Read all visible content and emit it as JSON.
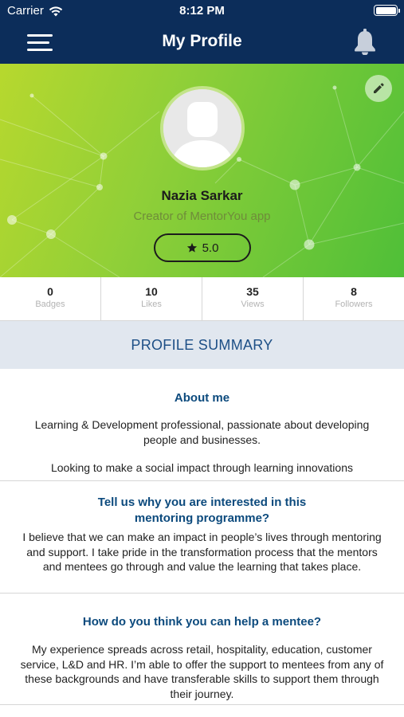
{
  "status_bar": {
    "carrier": "Carrier",
    "time": "8:12 PM"
  },
  "nav": {
    "title": "My Profile",
    "menu_icon": "hamburger-menu-icon",
    "bell_icon": "bell-icon"
  },
  "profile": {
    "name": "Nazia Sarkar",
    "role": "Creator of MentorYou app",
    "rating": "5.0",
    "rating_icon": "star-icon",
    "edit_icon": "pencil-icon"
  },
  "stats": [
    {
      "value": "0",
      "label": "Badges"
    },
    {
      "value": "10",
      "label": "Likes"
    },
    {
      "value": "35",
      "label": "Views"
    },
    {
      "value": "8",
      "label": "Followers"
    }
  ],
  "summary_tab": "PROFILE SUMMARY",
  "sections": {
    "about": {
      "heading": "About me",
      "body_1": "Learning & Development professional, passionate about developing people and businesses.",
      "body_2": "Looking to make a social impact through learning innovations"
    },
    "interest": {
      "heading": "Tell us why you are interested in this mentoring programme?",
      "body": "I believe that we can make an impact in people’s lives through mentoring and support. I take pride in the transformation process that the mentors and mentees go through and value the learning that takes place."
    },
    "help": {
      "heading": "How do you think you can help a mentee?",
      "body": "My experience spreads across retail, hospitality, education, customer service, L&D and HR. I’m able to offer the support to mentees from any of these backgrounds and have transferable skills to support them through their journey."
    }
  },
  "colors": {
    "nav_background": "#0c2d5a",
    "heading_blue": "#0c4a7d",
    "hero_green_light": "#b7d82e",
    "hero_green_dark": "#4fbf38"
  }
}
